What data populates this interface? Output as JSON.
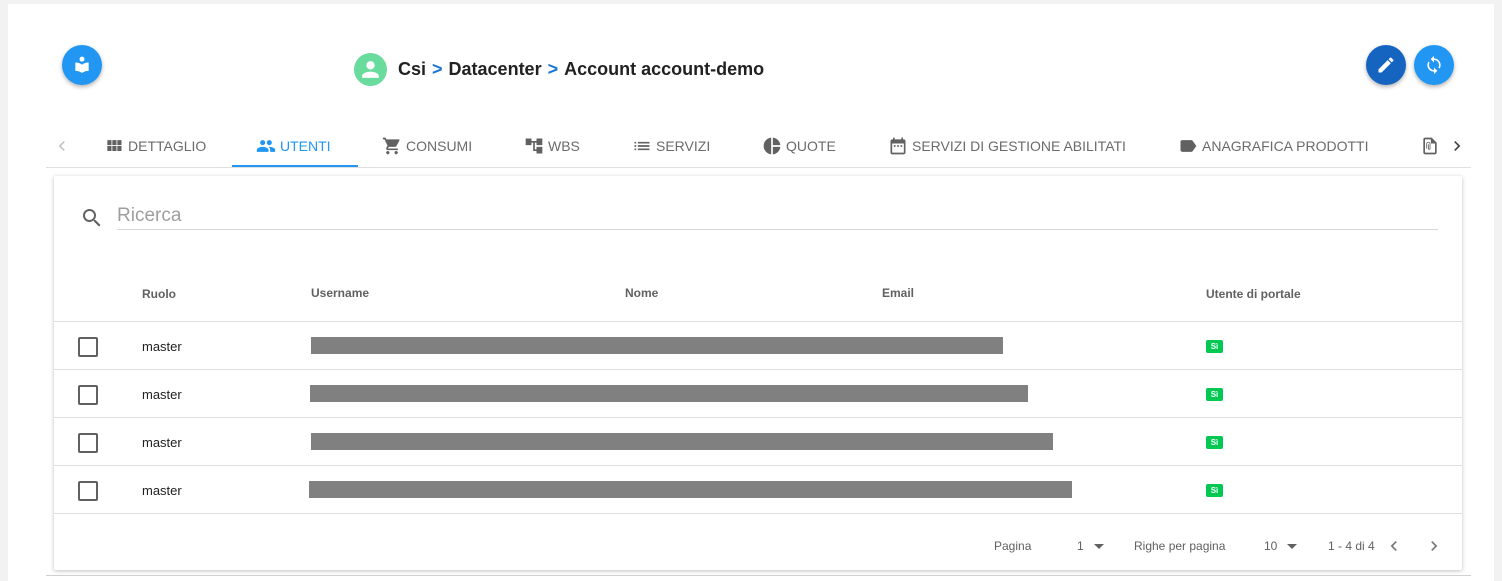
{
  "breadcrumb": {
    "items": [
      "Csi",
      "Datacenter",
      "Account account-demo"
    ],
    "separator": ">"
  },
  "tabs": [
    {
      "label": "DETTAGLIO",
      "icon": "grid-icon"
    },
    {
      "label": "UTENTI",
      "icon": "people-icon",
      "active": true
    },
    {
      "label": "CONSUMI",
      "icon": "cart-icon"
    },
    {
      "label": "WBS",
      "icon": "tree-icon"
    },
    {
      "label": "SERVIZI",
      "icon": "list-icon"
    },
    {
      "label": "QUOTE",
      "icon": "pie-icon"
    },
    {
      "label": "SERVIZI DI GESTIONE ABILITATI",
      "icon": "calendar-icon"
    },
    {
      "label": "ANAGRAFICA PRODOTTI",
      "icon": "label-icon"
    }
  ],
  "search": {
    "placeholder": "Ricerca",
    "value": ""
  },
  "table": {
    "columns": [
      "Ruolo",
      "Username",
      "Nome",
      "Email",
      "Utente di portale"
    ],
    "rows": [
      {
        "ruolo": "master",
        "portale": "Sì",
        "redacted": true
      },
      {
        "ruolo": "master",
        "portale": "Sì",
        "redacted": true
      },
      {
        "ruolo": "master",
        "portale": "Sì",
        "redacted": true
      },
      {
        "ruolo": "master",
        "portale": "Sì",
        "redacted": true
      }
    ]
  },
  "pagination": {
    "page_label": "Pagina",
    "page_value": "1",
    "rows_label": "Righe per pagina",
    "rows_value": "10",
    "range": "1 - 4 di 4"
  },
  "colors": {
    "primary": "#2196f3",
    "primary_dark": "#1565c0",
    "avatar": "#69db9c",
    "badge": "#00c853"
  }
}
